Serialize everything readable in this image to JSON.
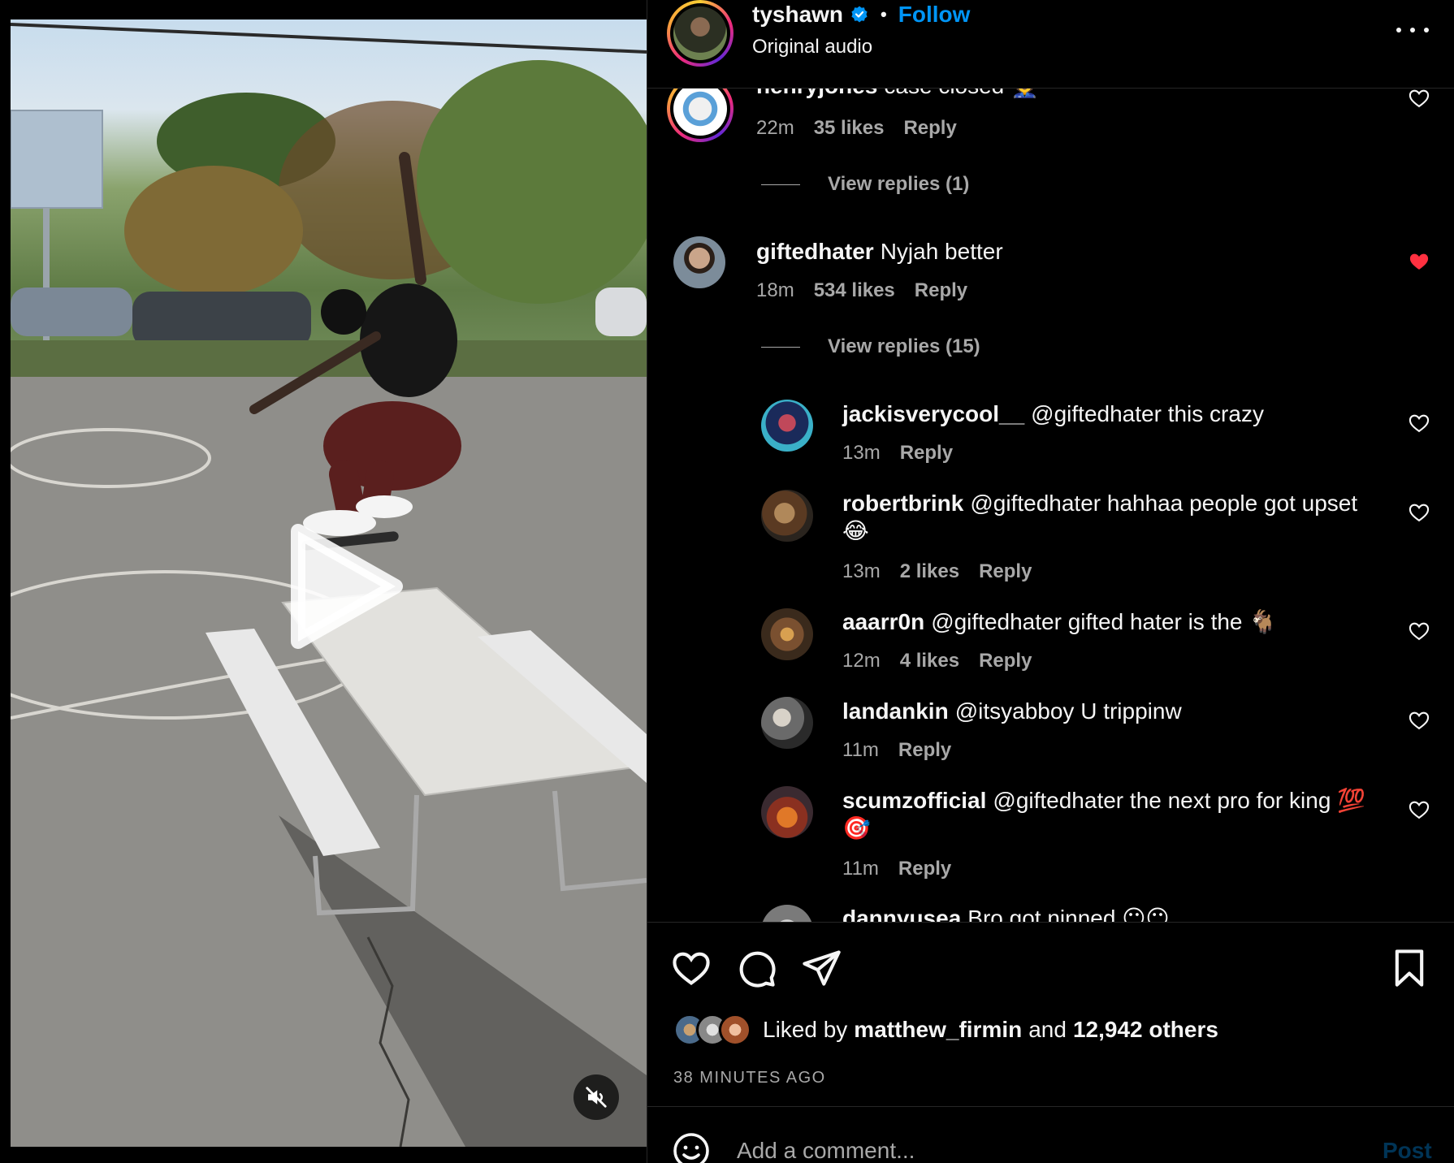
{
  "post": {
    "author": "tyshawn",
    "verified": true,
    "follow_label": "Follow",
    "audio": "Original audio",
    "more_icon": "more-horizontal-icon"
  },
  "video": {
    "play_icon": "play-icon",
    "mute_icon": "volume-muted-icon"
  },
  "comments": [
    {
      "user": "henryjones",
      "text": "case closed 👮",
      "time": "22m",
      "likes": "35 likes",
      "reply": "Reply",
      "view_replies": "View replies (1)",
      "liked": false
    },
    {
      "user": "giftedhater",
      "text": "Nyjah better",
      "time": "18m",
      "likes": "534 likes",
      "reply": "Reply",
      "view_replies": "View replies (15)",
      "liked": true
    }
  ],
  "replies": [
    {
      "user": "jackisverycool__",
      "text": "@giftedhater this crazy",
      "time": "13m",
      "likes": "",
      "reply": "Reply"
    },
    {
      "user": "robertbrink",
      "text": "@giftedhater hahhaa people got upset",
      "text2": "😂",
      "time": "13m",
      "likes": "2 likes",
      "reply": "Reply"
    },
    {
      "user": "aaarr0n",
      "text": "@giftedhater gifted hater is the 🐐",
      "time": "12m",
      "likes": "4 likes",
      "reply": "Reply"
    },
    {
      "user": "landankin",
      "text": "@itsyabboy U trippinw",
      "time": "11m",
      "likes": "",
      "reply": "Reply"
    },
    {
      "user": "scumzofficial",
      "text": "@giftedhater the next pro for king 💯",
      "text2": "🎯",
      "time": "11m",
      "likes": "",
      "reply": "Reply"
    },
    {
      "user": "dannyusea",
      "text": "Bro got ninned 😶😶",
      "time": "",
      "likes": "",
      "reply": ""
    }
  ],
  "actions": {
    "like_icon": "heart-icon",
    "comment_icon": "comment-icon",
    "share_icon": "paper-plane-icon",
    "save_icon": "bookmark-icon",
    "liked_by_prefix": "Liked by",
    "liked_by_user": "matthew_firmin",
    "liked_by_and": "and",
    "liked_by_others": "12,942 others",
    "time_ago": "38 MINUTES AGO"
  },
  "composer": {
    "placeholder": "Add a comment...",
    "post_label": "Post",
    "emoji_icon": "emoji-icon"
  },
  "colors": {
    "accent": "#0095f6",
    "like_red": "#ff3040",
    "muted": "#a8a8a8"
  }
}
